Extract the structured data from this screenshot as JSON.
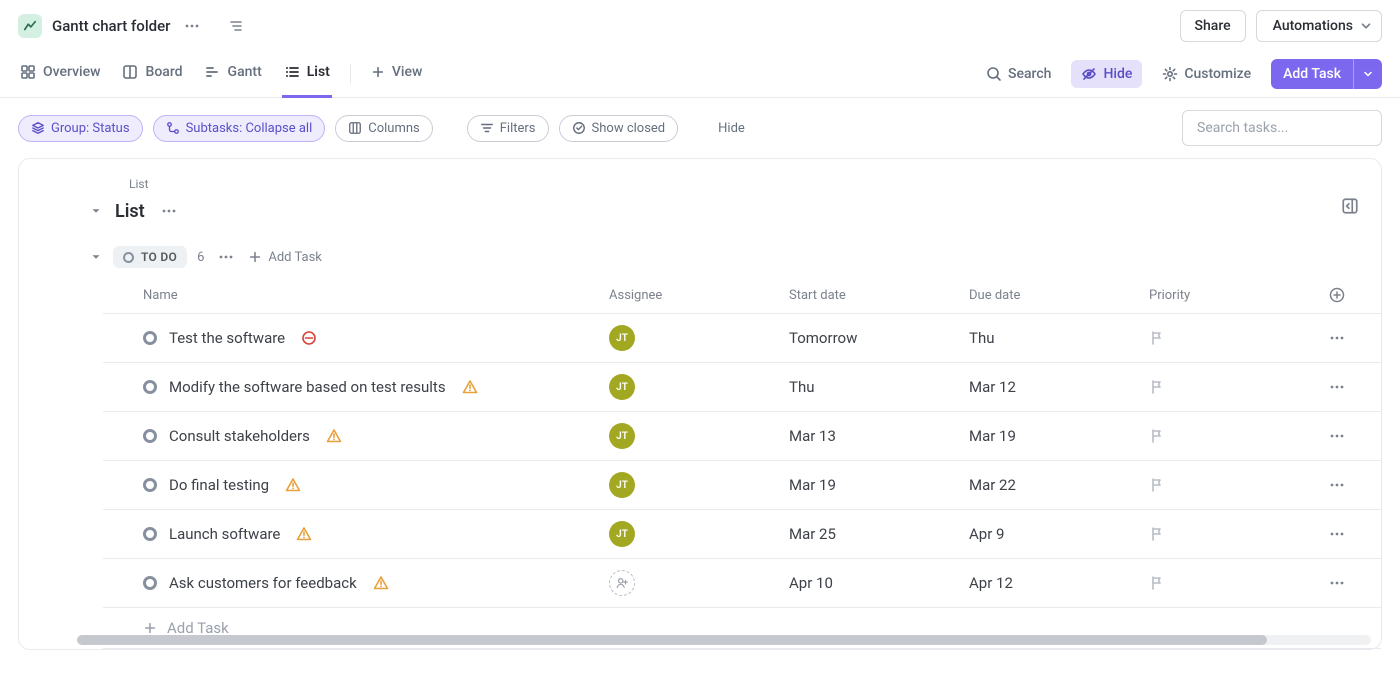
{
  "colors": {
    "accent": "#7b68ee",
    "avatar": "#a3a822"
  },
  "topbar": {
    "title": "Gantt chart folder",
    "share_label": "Share",
    "automations_label": "Automations"
  },
  "views": {
    "overview": "Overview",
    "board": "Board",
    "gantt": "Gantt",
    "list": "List",
    "add_view": "View"
  },
  "tools": {
    "search": "Search",
    "hide": "Hide",
    "customize": "Customize",
    "add_task": "Add Task"
  },
  "filters": {
    "group": "Group: Status",
    "subtasks": "Subtasks: Collapse all",
    "columns": "Columns",
    "filters": "Filters",
    "show_closed": "Show closed",
    "hide": "Hide",
    "search_placeholder": "Search tasks..."
  },
  "panel": {
    "breadcrumb": "List",
    "title": "List"
  },
  "group": {
    "status": "TO DO",
    "count": "6",
    "add_task": "Add Task"
  },
  "columns": {
    "name": "Name",
    "assignee": "Assignee",
    "start": "Start date",
    "due": "Due date",
    "priority": "Priority"
  },
  "tasks": [
    {
      "name": "Test the software",
      "warn": "block",
      "assignee": "JT",
      "start": "Tomorrow",
      "due": "Thu"
    },
    {
      "name": "Modify the software based on test results",
      "warn": "warn",
      "assignee": "JT",
      "start": "Thu",
      "due": "Mar 12"
    },
    {
      "name": "Consult stakeholders",
      "warn": "warn",
      "assignee": "JT",
      "start": "Mar 13",
      "due": "Mar 19"
    },
    {
      "name": "Do final testing",
      "warn": "warn",
      "assignee": "JT",
      "start": "Mar 19",
      "due": "Mar 22"
    },
    {
      "name": "Launch software",
      "warn": "warn",
      "assignee": "JT",
      "start": "Mar 25",
      "due": "Apr 9"
    },
    {
      "name": "Ask customers for feedback",
      "warn": "warn",
      "assignee": "",
      "start": "Apr 10",
      "due": "Apr 12"
    }
  ],
  "add_row": "Add Task"
}
